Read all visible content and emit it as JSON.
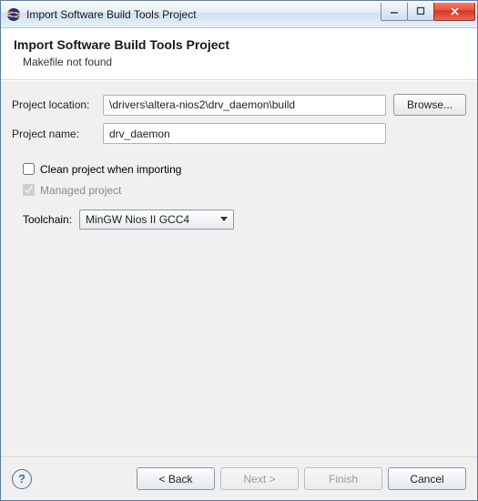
{
  "titlebar": {
    "title": "Import Software Build Tools Project"
  },
  "header": {
    "title": "Import Software Build Tools Project",
    "subtitle": "Makefile not found"
  },
  "form": {
    "project_location_label": "Project location:",
    "project_location_value": "\\drivers\\altera-nios2\\drv_daemon\\build",
    "browse_label": "Browse...",
    "project_name_label": "Project name:",
    "project_name_value": "drv_daemon",
    "clean_label": "Clean project when importing",
    "clean_checked": false,
    "managed_label": "Managed project",
    "managed_checked": true,
    "toolchain_label": "Toolchain:",
    "toolchain_value": "MinGW Nios II GCC4"
  },
  "footer": {
    "back_label": "< Back",
    "next_label": "Next >",
    "finish_label": "Finish",
    "cancel_label": "Cancel"
  }
}
